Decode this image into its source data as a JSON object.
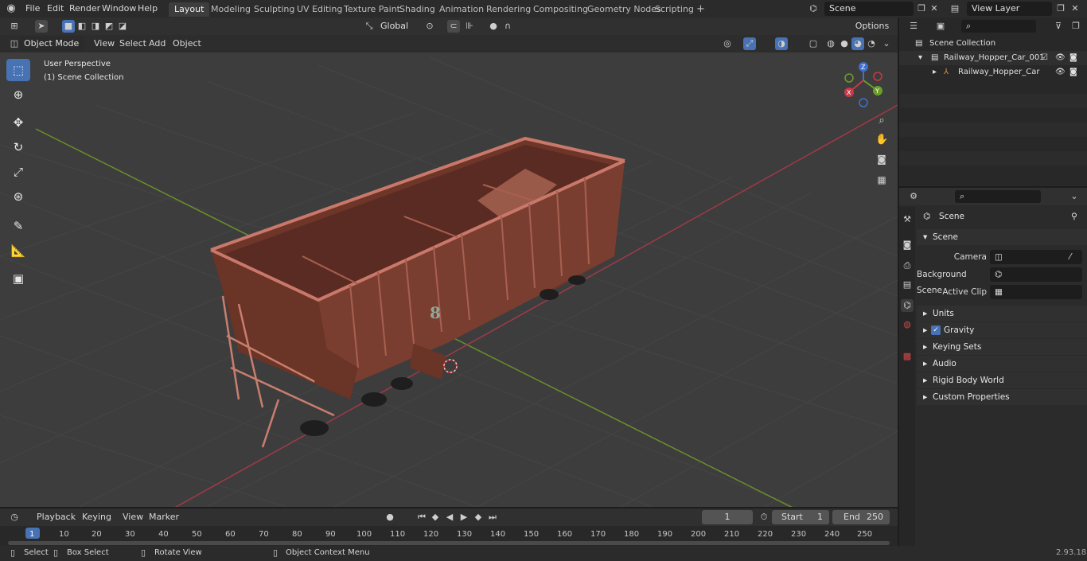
{
  "topbar": {
    "menus": [
      "File",
      "Edit",
      "Render",
      "Window",
      "Help"
    ],
    "workspaces": [
      "Layout",
      "Modeling",
      "Sculpting",
      "UV Editing",
      "Texture Paint",
      "Shading",
      "Animation",
      "Rendering",
      "Compositing",
      "Geometry Nodes",
      "Scripting"
    ],
    "active_workspace": "Layout",
    "add_tab": "+",
    "scene_name": "Scene",
    "view_layer": "View Layer"
  },
  "viewport_header": {
    "transform": "Global",
    "options": "Options"
  },
  "viewport_subheader": {
    "mode": "Object Mode",
    "view": "View",
    "select": "Select",
    "add": "Add",
    "object": "Object"
  },
  "viewport": {
    "perspective": "User Perspective",
    "collection": "(1) Scene Collection"
  },
  "gizmo": {
    "x": "X",
    "y": "Y",
    "z": "Z"
  },
  "outliner": {
    "root": "Scene Collection",
    "items": [
      {
        "label": "Railway_Hopper_Car_001"
      },
      {
        "label": "Railway_Hopper_Car"
      }
    ]
  },
  "properties": {
    "breadcrumb": "Scene",
    "panel_title": "Scene",
    "fields": [
      {
        "label": "Camera"
      },
      {
        "label": "Background Scene"
      },
      {
        "label": "Active Clip"
      }
    ],
    "subpanels": [
      "Units",
      "Gravity",
      "Keying Sets",
      "Audio",
      "Rigid Body World",
      "Custom Properties"
    ]
  },
  "timeline": {
    "menus": [
      "Playback",
      "Keying",
      "View",
      "Marker"
    ],
    "current_frame": "1",
    "start_label": "Start",
    "start": "1",
    "end_label": "End",
    "end": "250",
    "ticks": [
      "1",
      "10",
      "20",
      "30",
      "40",
      "50",
      "60",
      "70",
      "80",
      "90",
      "100",
      "110",
      "120",
      "130",
      "140",
      "150",
      "160",
      "170",
      "180",
      "190",
      "200",
      "210",
      "220",
      "230",
      "240",
      "250"
    ]
  },
  "statusbar": {
    "select": "Select",
    "box_select": "Box Select",
    "rotate_view": "Rotate View",
    "context_menu": "Object Context Menu",
    "version": "2.93.18"
  },
  "colors": {
    "accent": "#4772b3",
    "car_body": "#7a3e30",
    "car_light": "#c9786a",
    "x_axis": "#a03a48",
    "y_axis": "#6b8f2c"
  },
  "car_number": "8"
}
